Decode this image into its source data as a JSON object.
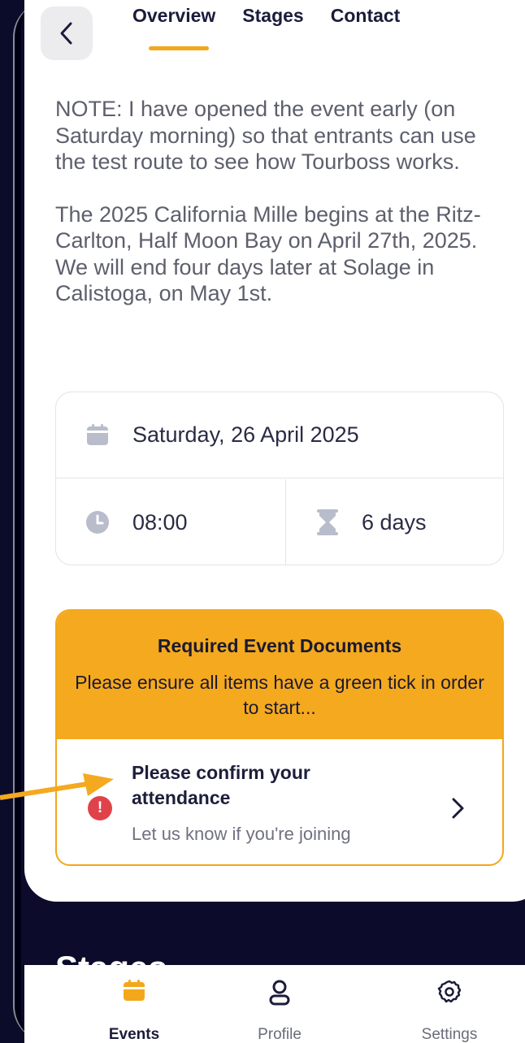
{
  "header": {
    "tabs": [
      {
        "label": "Overview",
        "active": true
      },
      {
        "label": "Stages",
        "active": false
      },
      {
        "label": "Contact",
        "active": false
      }
    ],
    "accent_color": "#f3a71a"
  },
  "description": {
    "note": "NOTE: I have opened the event early (on Saturday morning) so that entrants can use the test route to see how Tourboss works.",
    "body": "The 2025 California Mille begins at the Ritz-Carlton, Half Moon Bay on April 27th, 2025. We will end four days later at Solage in Calistoga, on May 1st."
  },
  "event_info": {
    "date": "Saturday, 26 April 2025",
    "time": "08:00",
    "duration": "6 days"
  },
  "documents": {
    "title": "Required Event Documents",
    "subtitle": "Please ensure all items have a green tick in order to start...",
    "items": [
      {
        "title": "Please confirm your attendance",
        "subtitle": "Let us know if you're joining",
        "status": "alert"
      }
    ]
  },
  "section_peek": {
    "label": "Stages"
  },
  "bottom_nav": {
    "items": [
      {
        "label": "Events",
        "icon": "calendar-icon",
        "active": true
      },
      {
        "label": "Profile",
        "icon": "user-icon",
        "active": false
      },
      {
        "label": "Settings",
        "icon": "gear-icon",
        "active": false
      }
    ]
  }
}
